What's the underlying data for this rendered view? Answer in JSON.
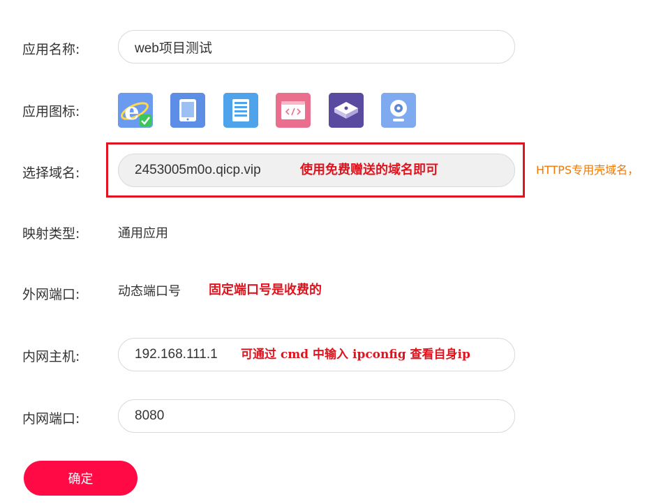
{
  "form": {
    "app_name": {
      "label": "应用名称:",
      "value": "web项目测试"
    },
    "app_icon": {
      "label": "应用图标:",
      "icons": [
        {
          "name": "ie-browser-icon",
          "selected": true,
          "color": "#5b8fe8"
        },
        {
          "name": "tablet-icon",
          "color": "#5d8ee6"
        },
        {
          "name": "server-icon",
          "color": "#4fa3ea"
        },
        {
          "name": "code-window-icon",
          "color": "#ea6f8f"
        },
        {
          "name": "network-switch-icon",
          "color": "#5a4aa0"
        },
        {
          "name": "webcam-icon",
          "color": "#7faaf0"
        }
      ]
    },
    "domain": {
      "label": "选择域名:",
      "value": "2453005m0o.qicp.vip",
      "annotation": "使用免费赠送的域名即可",
      "https_note": "HTTPS专用壳域名，"
    },
    "mapping_type": {
      "label": "映射类型:",
      "value": "通用应用"
    },
    "external_port": {
      "label": "外网端口:",
      "value": "动态端口号",
      "annotation": "固定端口号是收费的"
    },
    "internal_host": {
      "label": "内网主机:",
      "value": "192.168.111.1",
      "annotation": "可通过 cmd 中输入 ipconfig 查看自身ip"
    },
    "internal_port": {
      "label": "内网端口:",
      "value": "8080"
    },
    "confirm_label": "确定"
  },
  "colors": {
    "accent_button": "#ff0a45",
    "annotation_red": "#e0141e",
    "https_orange": "#f07800"
  }
}
